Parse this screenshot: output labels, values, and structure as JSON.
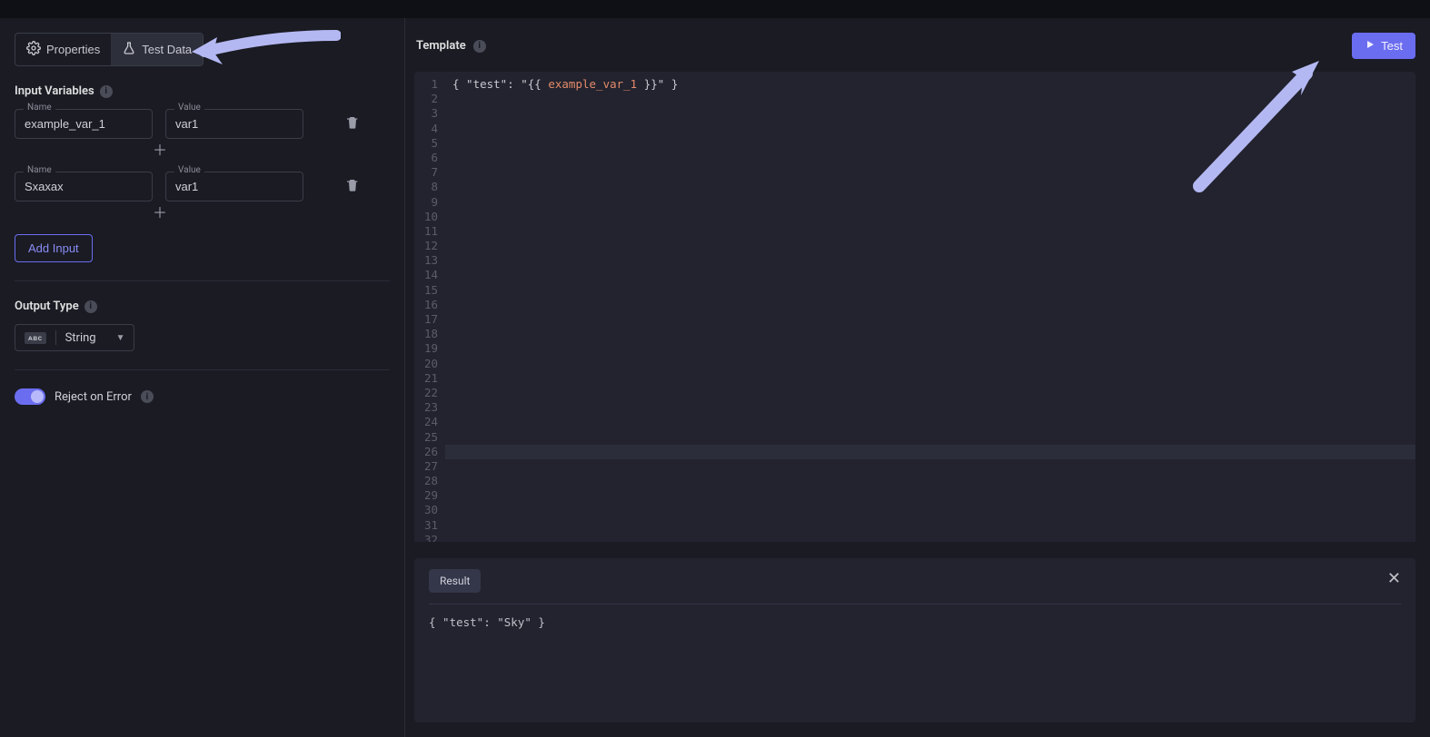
{
  "tabs": {
    "properties": "Properties",
    "test_data": "Test Data"
  },
  "sidebar": {
    "input_variables_title": "Input Variables",
    "name_label": "Name",
    "value_label": "Value",
    "rows": [
      {
        "name": "example_var_1",
        "value": "var1"
      },
      {
        "name": "Sxaxax",
        "value": "var1"
      }
    ],
    "add_input_label": "Add Input",
    "output_type_title": "Output Type",
    "output_type_selected": "String",
    "reject_on_error_label": "Reject on Error"
  },
  "editor": {
    "title": "Template",
    "test_button": "Test",
    "total_lines": 32,
    "active_line": 26,
    "line1_prefix": "{ \"test\": \"{{ ",
    "line1_var": "example_var_1",
    "line1_suffix": " }}\" }"
  },
  "result": {
    "tab_label": "Result",
    "body": "{ \"test\": \"Sky\" }"
  }
}
